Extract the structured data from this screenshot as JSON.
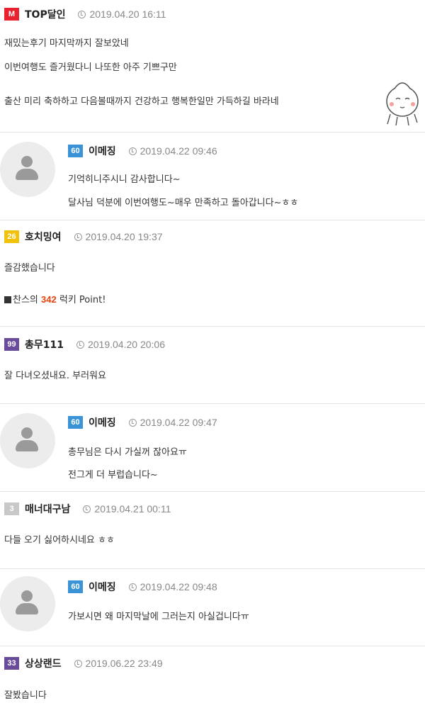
{
  "colors": {
    "top": "#e8222e",
    "lv60": "#3a93d6",
    "lv26": "#f0c20c",
    "lv99": "#6a4a9a",
    "lv3": "#c8c8c8",
    "lv33": "#6a4a9a",
    "points": "#e8410e"
  },
  "comments": [
    {
      "level": "M",
      "nick": "TOP달인",
      "date": "2019.04.20 16:11",
      "lines": [
        "재밌는후기 마지막까지 잘보았네",
        "이번여행도 즐거웠다니 나또한 아주 기쁘구만",
        "출산 미리 축하하고 다음볼때까지 건강하고 행복한일만 가득하길 바라네"
      ]
    },
    {
      "level": "60",
      "nick": "이메징",
      "date": "2019.04.22 09:46",
      "lines": [
        "기억히니주시니 감사합니다~",
        "달사님 덕분에 이번여행도~매우 만족하고 돌아갑니다~ㅎㅎ"
      ]
    },
    {
      "level": "26",
      "nick": "호치밍여",
      "date": "2019.04.20 19:37",
      "lines": [
        "즐감했습니다"
      ],
      "lucky": {
        "prefix": "찬스의",
        "points": "342",
        "suffix": "럭키 Point!"
      }
    },
    {
      "level": "99",
      "nick": "총무111",
      "date": "2019.04.20 20:06",
      "lines": [
        "잘 다녀오셨내요. 부러워요"
      ]
    },
    {
      "level": "60",
      "nick": "이메징",
      "date": "2019.04.22 09:47",
      "lines": [
        "총무님은 다시 가실꺼 잖아요ㅠ",
        "전그게 더 부럽습니다~"
      ]
    },
    {
      "level": "3",
      "nick": "매너대구남",
      "date": "2019.04.21 00:11",
      "lines": [
        "다들 오기 싫어하시네요 ㅎㅎ"
      ]
    },
    {
      "level": "60",
      "nick": "이메징",
      "date": "2019.04.22 09:48",
      "lines": [
        "가보시면 왜 마지막날에 그러는지 아실겁니다ㅠ"
      ]
    },
    {
      "level": "33",
      "nick": "상상랜드",
      "date": "2019.06.22 23:49",
      "lines": [
        "잘봤습니다"
      ]
    }
  ]
}
